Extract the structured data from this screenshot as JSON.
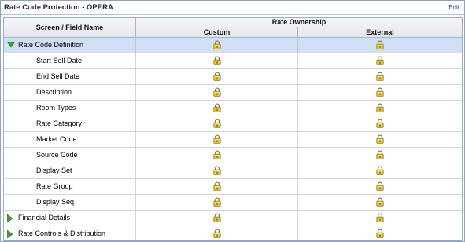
{
  "header": {
    "title": "Rate Code Protection - OPERA",
    "edit_label": "Edit"
  },
  "columns": {
    "field": "Screen / Field Name",
    "group": "Rate Ownership",
    "custom": "Custom",
    "external": "External"
  },
  "icons": {
    "lock": "lock-icon",
    "expanded": "triangle-down-icon",
    "collapsed": "triangle-right-icon"
  },
  "colors": {
    "selected_row": "#cfe0f5",
    "expander": "#3aa02a",
    "lock_body": "#e4c437"
  },
  "rows": [
    {
      "label": "Rate Code Definition",
      "level": 1,
      "expander": "expanded",
      "selected": true,
      "custom": "locked",
      "external": "locked"
    },
    {
      "label": "Start Sell Date",
      "level": 2,
      "custom": "locked",
      "external": "locked"
    },
    {
      "label": "End Sell Date",
      "level": 2,
      "custom": "locked",
      "external": "locked"
    },
    {
      "label": "Description",
      "level": 2,
      "custom": "locked",
      "external": "locked"
    },
    {
      "label": "Room Types",
      "level": 2,
      "custom": "locked",
      "external": "locked"
    },
    {
      "label": "Rate Category",
      "level": 2,
      "custom": "locked",
      "external": "locked"
    },
    {
      "label": "Market Code",
      "level": 2,
      "custom": "locked",
      "external": "locked"
    },
    {
      "label": "Source Code",
      "level": 2,
      "custom": "locked",
      "external": "locked"
    },
    {
      "label": "Display Set",
      "level": 2,
      "custom": "locked",
      "external": "locked"
    },
    {
      "label": "Rate Group",
      "level": 2,
      "custom": "locked",
      "external": "locked"
    },
    {
      "label": "Display Seq",
      "level": 2,
      "custom": "locked",
      "external": "locked"
    },
    {
      "label": "Financial Details",
      "level": 1,
      "expander": "collapsed",
      "custom": "locked",
      "external": "locked"
    },
    {
      "label": "Rate Controls & Distribution",
      "level": 1,
      "expander": "collapsed",
      "custom": "locked",
      "external": "locked"
    }
  ]
}
